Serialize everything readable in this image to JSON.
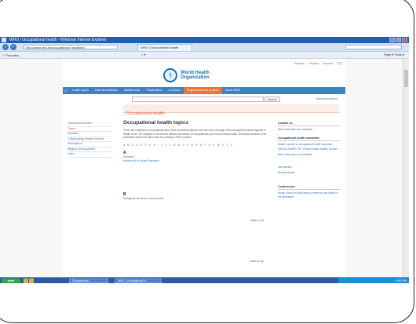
{
  "browser": {
    "title": "WHO | Occupational health - Windows Internet Explorer",
    "address": "http://www.who.int/occupational_health/en/",
    "tab": "WHO | Occupational health",
    "favorites": "Favorites",
    "page_menu": "Page ▾  Tools ▾"
  },
  "site": {
    "util_links": [
      "Español",
      "Français",
      "Русский",
      "中文"
    ],
    "org_line1": "World Health",
    "org_line2": "Organization",
    "nav": [
      "Health topics",
      "Data and statistics",
      "Media centre",
      "Publications",
      "Countries",
      "Programmes and projects",
      "About WHO"
    ],
    "search_button": "Search",
    "advanced_search": "Advanced search",
    "section_title": "Occupational health"
  },
  "sidebar": {
    "items": [
      "Occupational health",
      "Topics",
      "Activities",
      "Collaborating centres network",
      "Publications",
      "Regions and countries",
      "Links"
    ]
  },
  "main": {
    "heading": "Occupational health topics",
    "intro": "These are examples of occupational risks. Most risk factors listed in this index are coverage of the occupational health agenda of Health-Scan. The majority of the themes indexed are based on Occupational and Environmental health. Use these sections of the publication linked from this index for pointing to WHO content.",
    "alphabet": [
      "A",
      "B",
      "C",
      "D",
      "E",
      "F",
      "G",
      "H",
      "I",
      "J",
      "K",
      "L",
      "M",
      "N",
      "O",
      "P",
      "Q",
      "R",
      "S",
      "T",
      "U",
      "V",
      "W",
      "X",
      "Y",
      "Z"
    ],
    "groups": [
      {
        "letter": "A",
        "entries": [
          "Asbestos",
          "Ambient Air & Noise Exposure"
        ]
      },
      {
        "letter": "B",
        "entries": [
          "Biological risk factors and hazards"
        ]
      }
    ],
    "to_top": "↑ Back to Top"
  },
  "right": {
    "contact_heading": "Contact us",
    "contact_link": "More information for contacting",
    "links_heading": "Occupational health newsletter",
    "links": [
      "Mobile: Update on occupational health resources",
      "WHO/ILO/UNEP: TB - Protect health, healthy workers",
      "More information on newsletter",
      "Join website",
      "Global network"
    ],
    "events_heading": "Conferences",
    "events": [
      "Health, Work and Well-being conference and Health in the Workplace"
    ]
  },
  "taskbar": {
    "start": "start",
    "tasks": [
      "Occupational...",
      "WHO | Occupational h..."
    ],
    "clock": "2:08 PM"
  }
}
